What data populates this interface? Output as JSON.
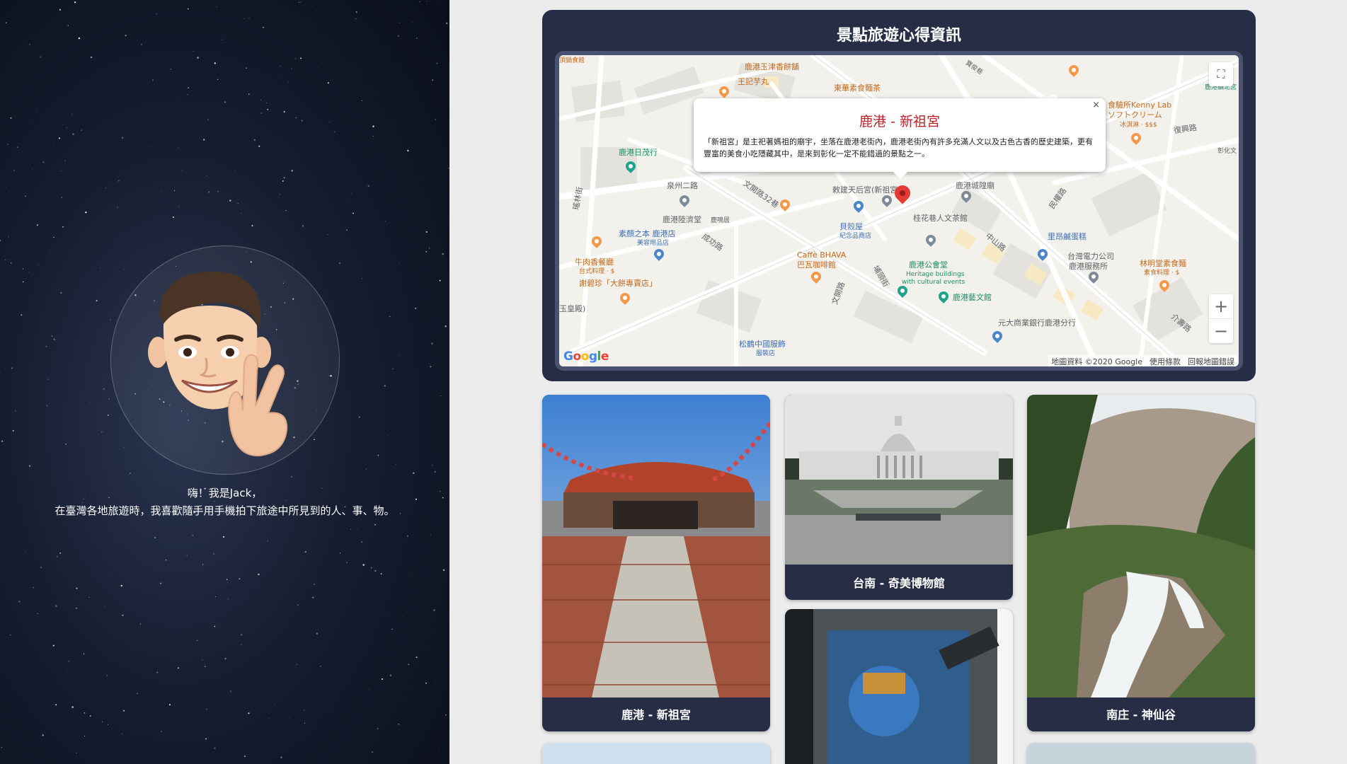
{
  "intro": {
    "line1": "嗨！我是Jack，",
    "line2": "在臺灣各地旅遊時，我喜歡隨手用手機拍下旅途中所見到的人、事、物。"
  },
  "map_section": {
    "title": "景點旅遊心得資訊",
    "info_window": {
      "title": "鹿港 - 新祖宮",
      "description": "「新祖宮」是主祀著媽祖的廟宇，坐落在鹿港老街內，鹿港老街內有許多充滿人文以及古色古香的歷史建築，更有豐富的美食小吃隱藏其中，是來到彰化一定不能錯過的景點之一。",
      "close": "×"
    },
    "labels": {
      "l1": "頂鍋食館",
      "l2": "鹿港玉津香餅舖",
      "l3": "王記芋丸",
      "l4": "東華素食麵茶",
      "l5": "寶俊巷",
      "l6": "食驗所Kenny Lab",
      "l7": "ソフトクリーム",
      "l8": "冰淇淋 · $$$",
      "l9": "復興路",
      "l10": "鹿港日茂行",
      "l11": "泉州二路",
      "l12": "鹿港城隍廟",
      "l13": "敕建天后宮(新祖宮)",
      "l14": "鹿港陸濟堂",
      "l15": "鹿鳴居",
      "l16": "貝殼屋",
      "l17": "紀念品商店",
      "l18": "桂花巷人文茶館",
      "l19": "素顏之本 鹿港店",
      "l20": "美容用品店",
      "l21": "牛肉香餐廳",
      "l22": "台式料理 · $",
      "l23": "Caffè BHAVA",
      "l24": "巴瓦咖啡館",
      "l25": "中山路",
      "l26": "里昂鹹蛋糕",
      "l27": "台灣電力公司",
      "l28": "鹿港服務所",
      "l29": "林明堂素食麵",
      "l30": "素食料理 · $",
      "l31": "謝碧珍「大餅專賣店」",
      "l32": "鹿港公會堂",
      "l33": "Heritage buildings",
      "l34": "with cultural events",
      "l35": "鹿港藝文館",
      "l36": "玉皇殿)",
      "l37": "元大商業銀行鹿港分行",
      "l38": "松鶴中國服飾",
      "l39": "服裝店",
      "l40": "成功路",
      "l41": "民權路",
      "l42": "文開路32巷",
      "l43": "鹿港鎮北宮",
      "l44": "彰化文",
      "l45": "介壽路",
      "l46": "埔頭街",
      "l47": "文開路",
      "l48": "瑤林街"
    },
    "google": {
      "g": "G",
      "o1": "o",
      "o2": "o",
      "g2": "g",
      "l": "l",
      "e": "e"
    },
    "footer": {
      "data": "地圖資料 ©2020 Google",
      "terms": "使用條款",
      "report": "回報地圖錯誤"
    },
    "zoom_in": "+",
    "zoom_out": "−",
    "fullscreen": "⛶"
  },
  "gallery": {
    "item1": "鹿港 - 新祖宮",
    "item2": "台南 - 奇美博物館",
    "item3": "南庄 - 神仙谷"
  },
  "colors": {
    "card_bg": "#262d45",
    "info_title": "#c2202b",
    "page_bg": "#ececec"
  }
}
